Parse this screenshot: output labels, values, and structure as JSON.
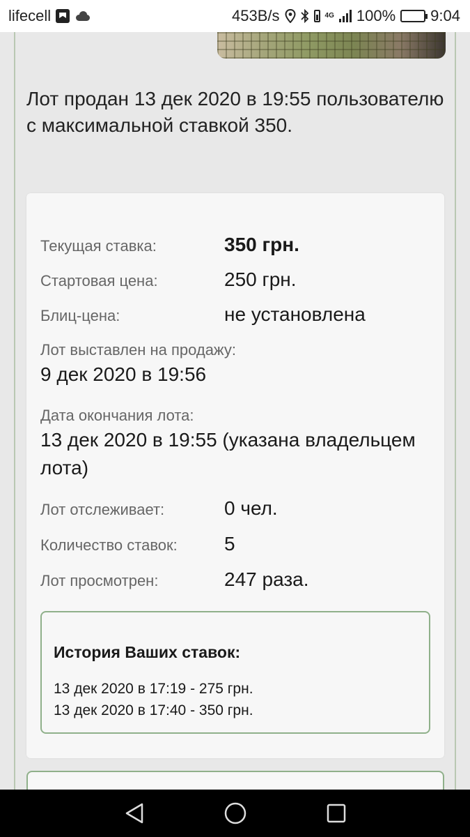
{
  "status_bar": {
    "carrier": "lifecell",
    "speed": "453B/s",
    "network": "4G",
    "battery": "100%",
    "time": "9:04"
  },
  "lot": {
    "sold_message": "Лот продан 13 дек 2020 в 19:55 пользователю с максимальной ставкой 350."
  },
  "details": {
    "current_bid": {
      "label": "Текущая ставка:",
      "value": "350 грн."
    },
    "start_price": {
      "label": "Стартовая цена:",
      "value": "250 грн."
    },
    "blitz_price": {
      "label": "Блиц-цена:",
      "value": "не установлена"
    },
    "listed": {
      "label": "Лот выставлен на продажу:",
      "value": "9 дек 2020 в 19:56"
    },
    "end_date": {
      "label": "Дата окончания лота:",
      "value": "13 дек 2020 в 19:55 (указана владельцем лота)"
    },
    "watchers": {
      "label": "Лот отслеживает:",
      "value": "0 чел."
    },
    "bids_count": {
      "label": "Количество ставок:",
      "value": "5"
    },
    "views": {
      "label": "Лот просмотрен:",
      "value": "247 раза."
    }
  },
  "history": {
    "title": "История Ваших ставок:",
    "items": [
      "13 дек 2020 в 17:19 - 275 грн.",
      "13 дек 2020 в 17:40 - 350 грн."
    ]
  },
  "colors": {
    "card_border": "#8fb08a",
    "battery_fill": "#3cb043"
  },
  "icons": [
    "sim-icon",
    "cloud-icon",
    "location-pin-icon",
    "bluetooth-icon",
    "signal-icon",
    "battery-icon",
    "back-icon",
    "home-icon",
    "recents-icon"
  ]
}
